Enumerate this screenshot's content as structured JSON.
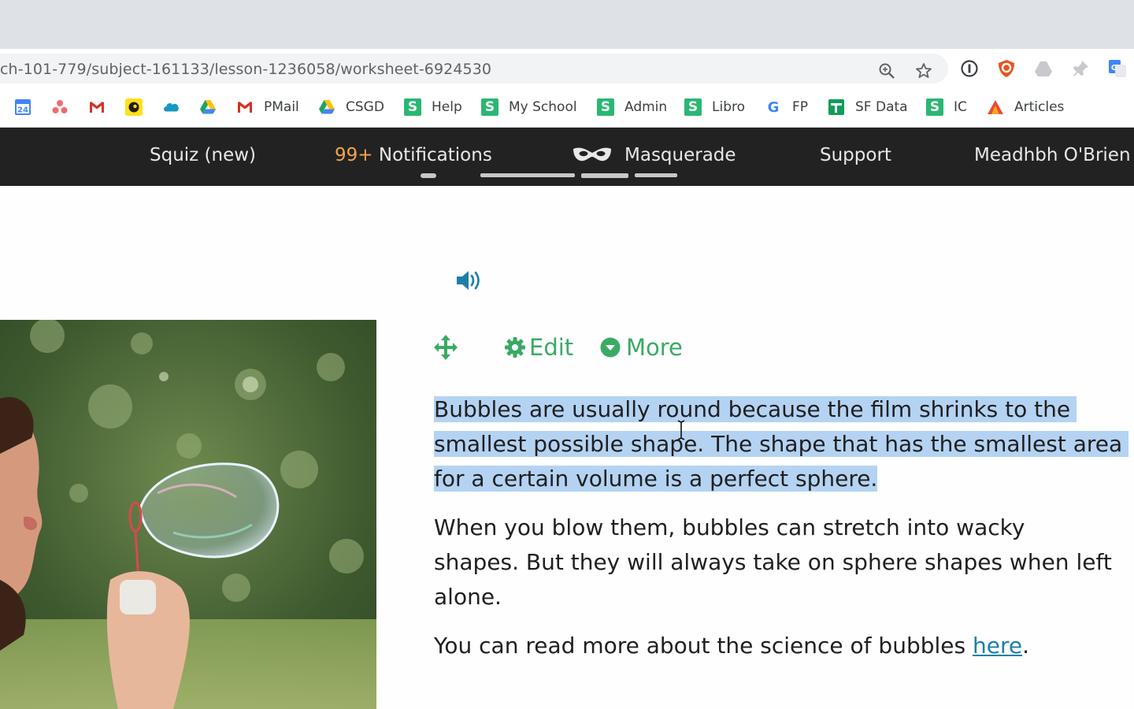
{
  "browser": {
    "url": "ch-101-779/subject-161133/lesson-1236058/worksheet-6924530",
    "bookmarks": [
      {
        "icon": "calendar-icon",
        "label": "",
        "calendar_day": "24"
      },
      {
        "icon": "asana-icon",
        "label": ""
      },
      {
        "icon": "gmail-icon",
        "label": ""
      },
      {
        "icon": "mailchimp-icon",
        "label": ""
      },
      {
        "icon": "salesforce-icon",
        "label": ""
      },
      {
        "icon": "google-drive-icon",
        "label": ""
      },
      {
        "icon": "gmail-icon",
        "label": "PMail"
      },
      {
        "icon": "google-drive-icon",
        "label": "CSGD"
      },
      {
        "icon": "s-icon",
        "label": "Help"
      },
      {
        "icon": "s-icon",
        "label": "My School"
      },
      {
        "icon": "s-icon",
        "label": "Admin"
      },
      {
        "icon": "s-icon",
        "label": "Libro"
      },
      {
        "icon": "google-icon",
        "label": "FP"
      },
      {
        "icon": "sheets-icon",
        "label": "SF Data"
      },
      {
        "icon": "s-icon",
        "label": "IC"
      },
      {
        "icon": "articles-icon",
        "label": "Articles"
      }
    ],
    "s_glyph": "S",
    "google_glyph": "G"
  },
  "nav": {
    "squiz": "Squiz (new)",
    "notifications_count": "99+",
    "notifications": "Notifications",
    "masquerade": "Masquerade",
    "support": "Support",
    "user": "Meadhbh O'Brien"
  },
  "content": {
    "actions": {
      "edit": "Edit",
      "more": "More"
    },
    "paragraph1_lines": [
      "Bubbles are usually round because the film shrinks to the",
      "smallest possible shape. The shape that has the smallest area",
      "for a certain volume is a perfect sphere."
    ],
    "paragraph2_lines": [
      "When you blow them, bubbles can stretch into wacky",
      "shapes. But they will always take on sphere shapes when left",
      "alone."
    ],
    "paragraph3": {
      "text": "You can read more about the science of bubbles ",
      "link": "here",
      "end": "."
    }
  },
  "colors": {
    "accent_green": "#3aaa64",
    "selection": "#b4d3f3",
    "link": "#1d7fa6",
    "nav_bg": "#222222",
    "notification_count": "#f0a64a"
  }
}
